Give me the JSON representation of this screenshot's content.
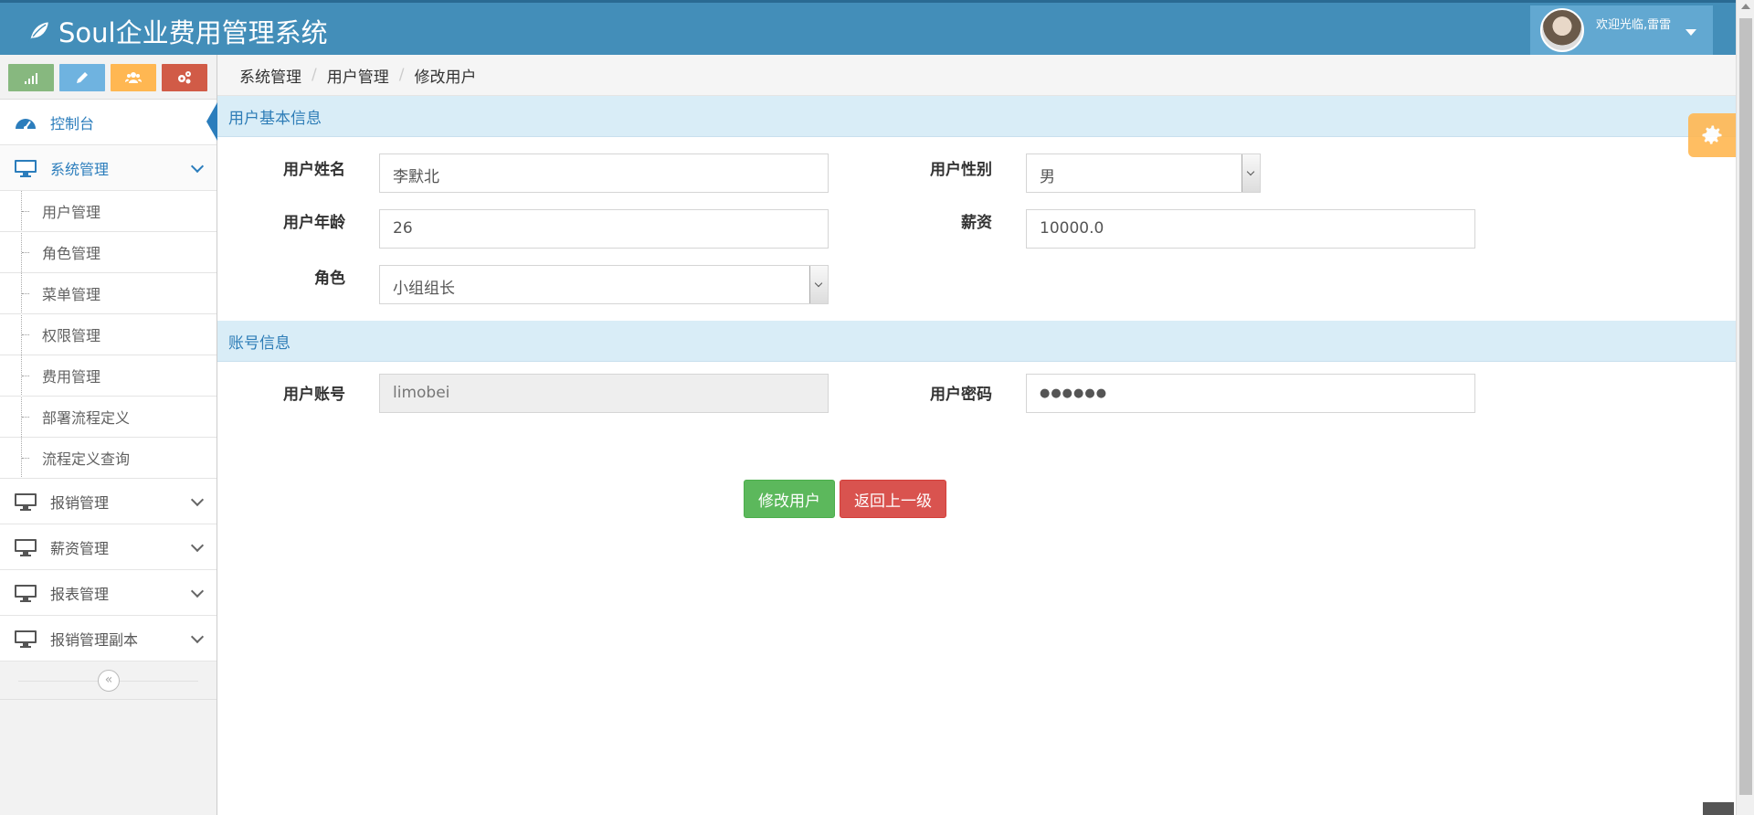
{
  "app": {
    "title": "Soul企业费用管理系统",
    "logo_icon": "leaf-icon"
  },
  "user": {
    "welcome": "欢迎光临,雷雷",
    "avatar_icon": "user-avatar"
  },
  "shortcuts": [
    {
      "name": "signal-icon",
      "color": "#87b87f"
    },
    {
      "name": "pencil-icon",
      "color": "#6fb3e0"
    },
    {
      "name": "users-icon",
      "color": "#ffb752"
    },
    {
      "name": "cogs-icon",
      "color": "#d15b47"
    }
  ],
  "sidebar": {
    "dashboard": "控制台",
    "system": "系统管理",
    "submenu": [
      "用户管理",
      "角色管理",
      "菜单管理",
      "权限管理",
      "费用管理",
      "部署流程定义",
      "流程定义查询"
    ],
    "others": [
      "报销管理",
      "薪资管理",
      "报表管理",
      "报销管理副本"
    ]
  },
  "breadcrumb": [
    "系统管理",
    "用户管理",
    "修改用户"
  ],
  "sections": {
    "basic": "用户基本信息",
    "account": "账号信息"
  },
  "form": {
    "name_label": "用户姓名",
    "name_value": "李默北",
    "gender_label": "用户性别",
    "gender_value": "男",
    "age_label": "用户年龄",
    "age_value": "26",
    "salary_label": "薪资",
    "salary_value": "10000.0",
    "role_label": "角色",
    "role_value": "小组组长",
    "account_label": "用户账号",
    "account_value": "limobei",
    "password_label": "用户密码",
    "password_value": "●●●●●●"
  },
  "buttons": {
    "submit": "修改用户",
    "back": "返回上一级"
  }
}
